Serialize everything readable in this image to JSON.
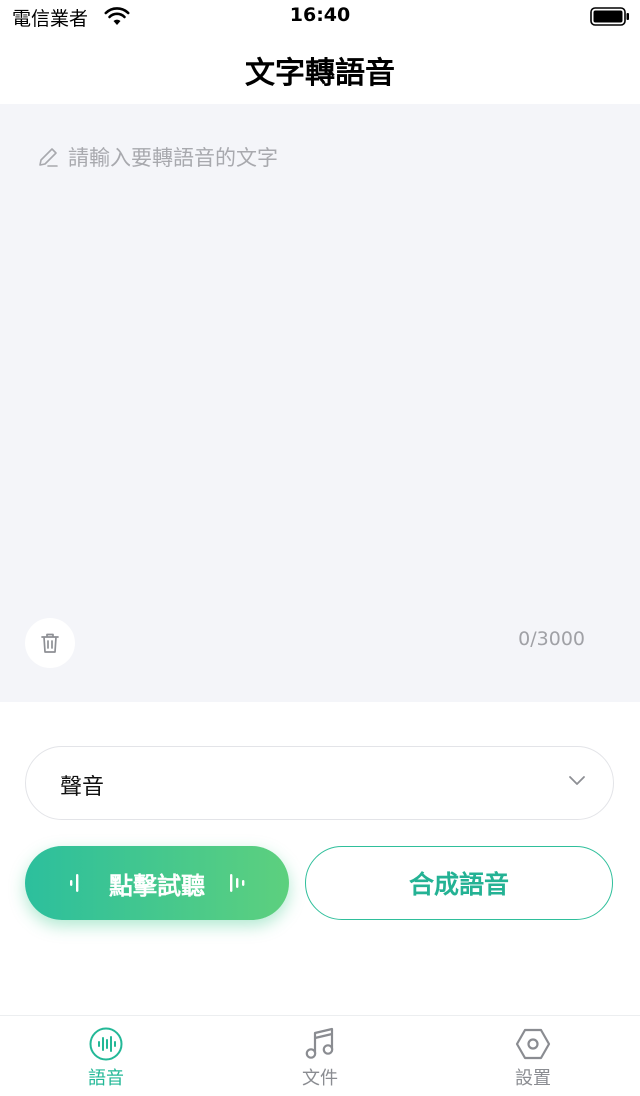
{
  "status_bar": {
    "carrier": "電信業者",
    "time": "16:40"
  },
  "header": {
    "title": "文字轉語音"
  },
  "editor": {
    "placeholder": "請輸入要轉語音的文字",
    "value": "",
    "char_count": "0/3000"
  },
  "voice_select": {
    "label": "聲音"
  },
  "actions": {
    "listen_label": "點擊試聽",
    "synthesize_label": "合成語音"
  },
  "tabs": [
    {
      "label": "語音",
      "icon": "voice-wave-icon",
      "active": true
    },
    {
      "label": "文件",
      "icon": "music-note-icon",
      "active": false
    },
    {
      "label": "設置",
      "icon": "hexagon-settings-icon",
      "active": false
    }
  ],
  "colors": {
    "accent": "#23b897",
    "gradient_start": "#2cbf9d",
    "gradient_end": "#5dd07e",
    "editor_bg": "#f4f5f9"
  }
}
